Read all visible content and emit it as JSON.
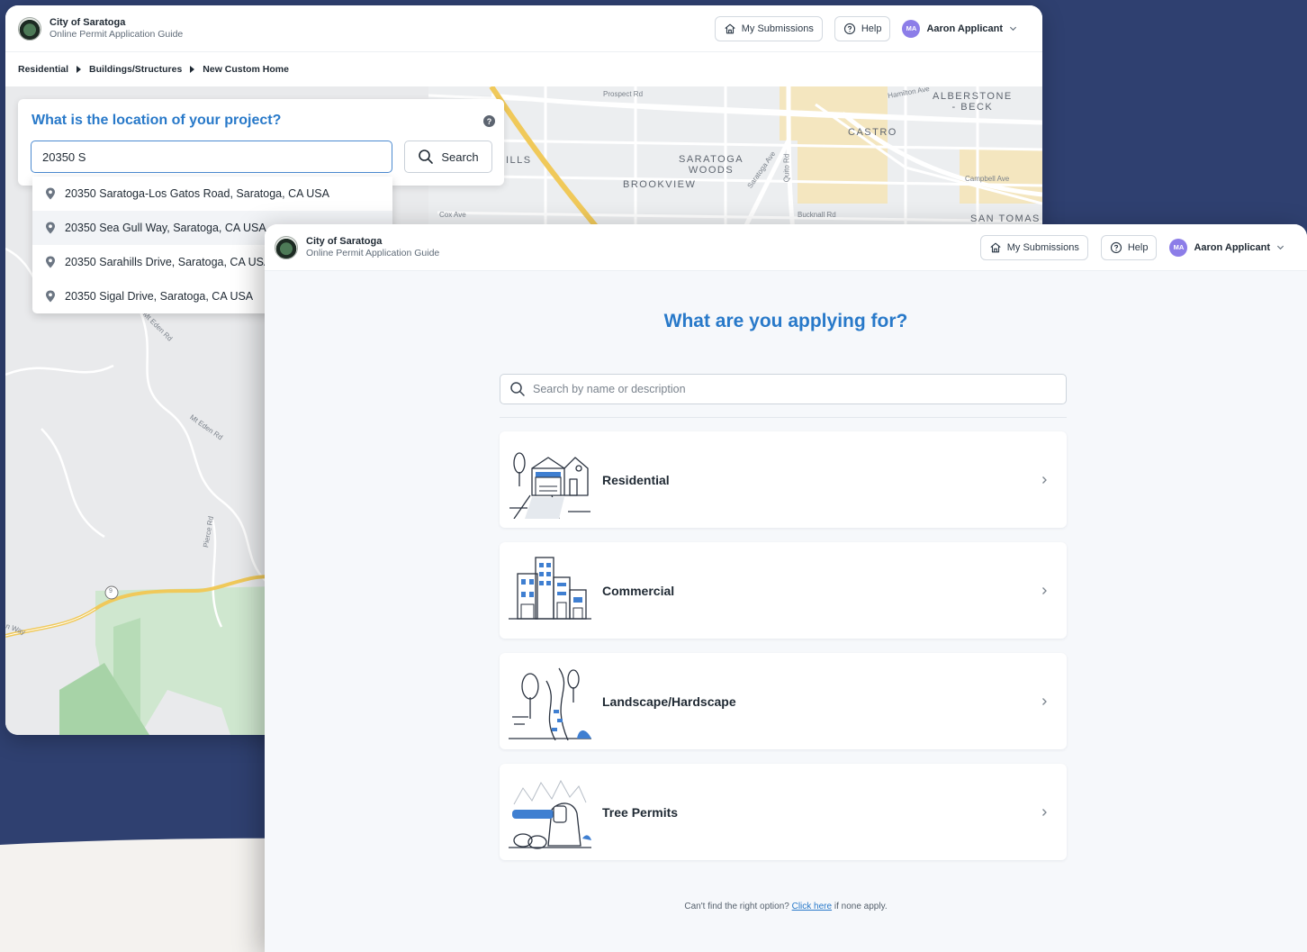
{
  "colors": {
    "background": "#2f4070",
    "accent": "#2879c9",
    "avatar": "#8c7de8"
  },
  "header": {
    "org_name": "City of Saratoga",
    "org_subtitle": "Online Permit Application Guide",
    "my_submissions": "My Submissions",
    "help": "Help",
    "user_initials": "MA",
    "user_name": "Aaron Applicant",
    "icons": [
      "home-icon",
      "help-circle-icon",
      "chevron-down-icon"
    ]
  },
  "back_window": {
    "breadcrumbs": [
      "Residential",
      "Buildings/Structures",
      "New Custom Home"
    ],
    "location_title": "What is the location of your project?",
    "help_glyph": "?",
    "search_value": "20350 S",
    "search_button": "Search",
    "suggestions": [
      "20350 Saratoga-Los Gatos Road, Saratoga, CA USA",
      "20350 Sea Gull Way, Saratoga, CA USA",
      "20350 Sarahills Drive, Saratoga, CA USA",
      "20350 Sigal Drive, Saratoga, CA USA"
    ],
    "map_labels": {
      "alberstone": "ALBERSTONE\n- BECK",
      "castro": "CASTRO",
      "saratoga_woods": "SARATOGA\nWOODS",
      "brookview": "BROOKVIEW",
      "san_tomas": "SAN TOMAS",
      "hills": "ILLS",
      "prospect": "Prospect Rd",
      "hamilton": "Hamilton Ave",
      "campbell": "Campbell Ave",
      "cox": "Cox Ave",
      "bucknall": "Bucknall Rd",
      "quito": "Quito Rd",
      "saratoga_ave": "Saratoga Ave",
      "mt_eden_1": "Mt Eden Rd",
      "mt_eden_2": "Mt Eden Rd",
      "pierce": "Pierce Rd",
      "route": "9",
      "way": "n Way"
    }
  },
  "front_window": {
    "title": "What are you applying for?",
    "search_placeholder": "Search by name or description",
    "categories": [
      {
        "label": "Residential",
        "icon": "house-garage-illustration"
      },
      {
        "label": "Commercial",
        "icon": "commercial-buildings-illustration"
      },
      {
        "label": "Landscape/Hardscape",
        "icon": "landscape-trees-illustration"
      },
      {
        "label": "Tree Permits",
        "icon": "chainsaw-stump-illustration"
      }
    ],
    "footnote_prefix": "Can't find the right option?",
    "footnote_link": "Click here",
    "footnote_suffix": "if none apply."
  }
}
